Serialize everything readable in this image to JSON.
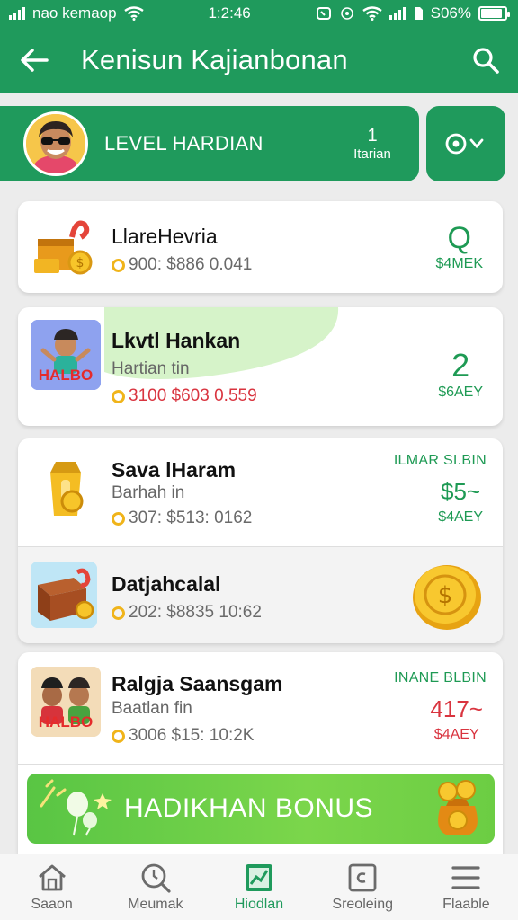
{
  "status_bar": {
    "carrier": "nao kemaop",
    "time": "1:2:46",
    "battery": "S06%",
    "battery_level": 0.9
  },
  "header": {
    "title": "Kenisun Kajianbonan"
  },
  "level": {
    "label": "LEVEL HARDIAN",
    "count": "1",
    "count_label": "Itarian"
  },
  "items": [
    {
      "name": "LlareHevria",
      "stat": "900: $886 0.041",
      "value": "Q",
      "value_label": "$4MEK"
    },
    {
      "name": "Lkvtl Hankan",
      "subtitle": "Hartian tin",
      "stat": "3100 $603 0.559",
      "value": "2",
      "value_label": "$6AEY",
      "thumb_text": "HALBO"
    },
    {
      "name": "Sava lHaram",
      "subtitle": "Barhah in",
      "stat": "307: $513: 0162",
      "tag": "ILMAR SI.BIN",
      "value": "$5~",
      "value_label": "$4AEY"
    },
    {
      "name": "Datjahcalal",
      "stat": "202: $8835 10:62"
    },
    {
      "name": "Ralgja Saansgam",
      "subtitle": "Baatlan fin",
      "stat": "3006 $15: 10:2K",
      "tag": "INANE BLBIN",
      "value": "417~",
      "value_label": "$4AEY",
      "thumb_text": "HALBO"
    }
  ],
  "bonus": {
    "label": "HADIKHAN BONUS"
  },
  "nav": [
    {
      "label": "Saaon",
      "icon": "home-icon"
    },
    {
      "label": "Meumak",
      "icon": "search-clock-icon"
    },
    {
      "label": "Hiodlan",
      "icon": "chart-icon"
    },
    {
      "label": "Sreoleing",
      "icon": "square-icon"
    },
    {
      "label": "Flaable",
      "icon": "menu-icon"
    }
  ],
  "colors": {
    "primary": "#1f9a5c",
    "accent_green": "#1e9a54",
    "accent_red": "#d9343f",
    "coin": "#f0b41a",
    "bonus_green": "#6ccd43"
  }
}
